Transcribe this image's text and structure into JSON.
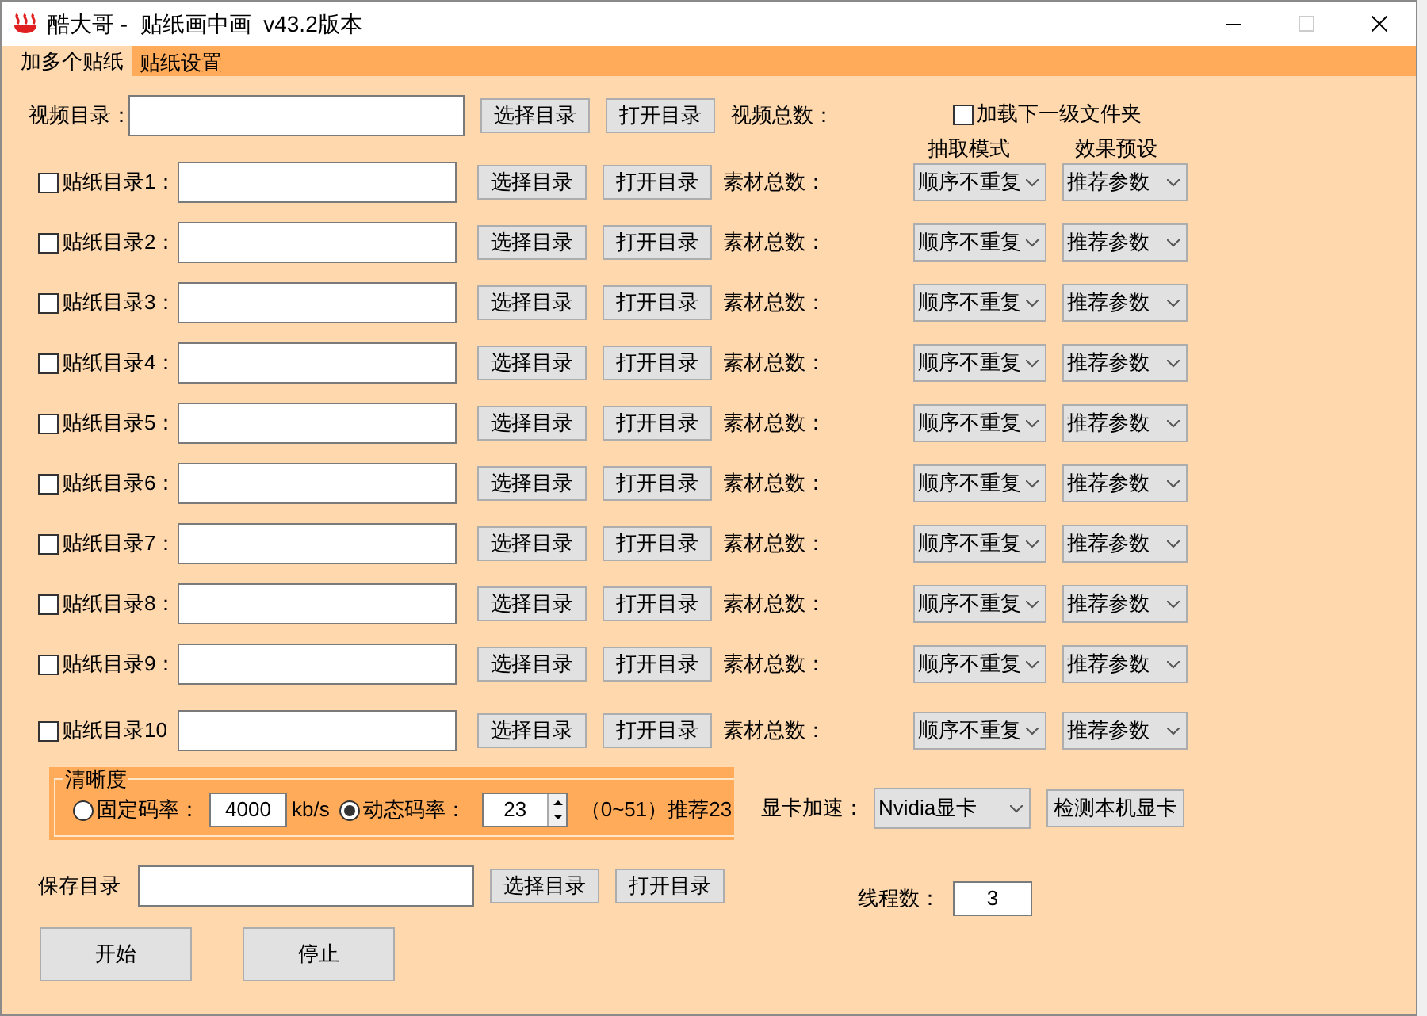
{
  "window": {
    "title": "酷大哥 -  贴纸画中画  v43.2版本"
  },
  "tabs": [
    {
      "label": "加多个贴纸",
      "selected": true
    },
    {
      "label": "贴纸设置",
      "selected": false
    }
  ],
  "video": {
    "label": "视频目录：",
    "select_button": "选择目录",
    "open_button": "打开目录",
    "total_label": "视频总数：",
    "load_subfolder": {
      "label": "加载下一级文件夹",
      "checked": false
    }
  },
  "column_headers": [
    "抽取模式",
    "效果预设"
  ],
  "stickers": [
    {
      "checked": false,
      "label": "贴纸目录1：",
      "select_button": "选择目录",
      "open_button": "打开目录",
      "total_label": "素材总数：",
      "mode": "顺序不重复",
      "preset": "推荐参数"
    },
    {
      "checked": false,
      "label": "贴纸目录2：",
      "select_button": "选择目录",
      "open_button": "打开目录",
      "total_label": "素材总数：",
      "mode": "顺序不重复",
      "preset": "推荐参数"
    },
    {
      "checked": false,
      "label": "贴纸目录3：",
      "select_button": "选择目录",
      "open_button": "打开目录",
      "total_label": "素材总数：",
      "mode": "顺序不重复",
      "preset": "推荐参数"
    },
    {
      "checked": false,
      "label": "贴纸目录4：",
      "select_button": "选择目录",
      "open_button": "打开目录",
      "total_label": "素材总数：",
      "mode": "顺序不重复",
      "preset": "推荐参数"
    },
    {
      "checked": false,
      "label": "贴纸目录5：",
      "select_button": "选择目录",
      "open_button": "打开目录",
      "total_label": "素材总数：",
      "mode": "顺序不重复",
      "preset": "推荐参数"
    },
    {
      "checked": false,
      "label": "贴纸目录6：",
      "select_button": "选择目录",
      "open_button": "打开目录",
      "total_label": "素材总数：",
      "mode": "顺序不重复",
      "preset": "推荐参数"
    },
    {
      "checked": false,
      "label": "贴纸目录7：",
      "select_button": "选择目录",
      "open_button": "打开目录",
      "total_label": "素材总数：",
      "mode": "顺序不重复",
      "preset": "推荐参数"
    },
    {
      "checked": false,
      "label": "贴纸目录8：",
      "select_button": "选择目录",
      "open_button": "打开目录",
      "total_label": "素材总数：",
      "mode": "顺序不重复",
      "preset": "推荐参数"
    },
    {
      "checked": false,
      "label": "贴纸目录9：",
      "select_button": "选择目录",
      "open_button": "打开目录",
      "total_label": "素材总数：",
      "mode": "顺序不重复",
      "preset": "推荐参数"
    },
    {
      "checked": false,
      "label": "贴纸目录10",
      "select_button": "选择目录",
      "open_button": "打开目录",
      "total_label": "素材总数：",
      "mode": "顺序不重复",
      "preset": "推荐参数"
    }
  ],
  "quality": {
    "title": "清晰度",
    "options": [
      {
        "label": "固定码率：",
        "selected": false,
        "value": "4000",
        "unit": "kb/s"
      },
      {
        "label": "动态码率：",
        "selected": true,
        "value": "23",
        "hint": "（0~51）推荐23"
      }
    ]
  },
  "gpu": {
    "label": "显卡加速：",
    "value": "Nvidia显卡",
    "button": "检测本机显卡"
  },
  "save": {
    "label": "保存目录",
    "select_button": "选择目录",
    "open_button": "打开目录"
  },
  "threads": {
    "label": "线程数：",
    "value": "3"
  },
  "actions": [
    "开始",
    "停止"
  ]
}
